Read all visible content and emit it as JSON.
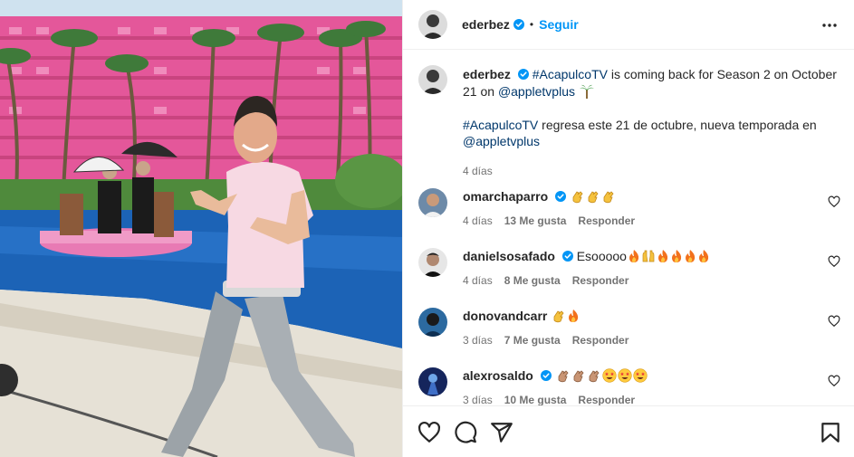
{
  "post": {
    "author": "ederbez",
    "separator": "•",
    "follow_label": "Seguir",
    "colors": {
      "accent": "#0095f6",
      "link": "#00376b",
      "muted": "#737373",
      "verified": "#0095f6"
    }
  },
  "caption": {
    "author": "ederbez",
    "line1": "#AcapulcoTV is coming back for Season 2 on October 21 on @appletvplus",
    "line1_tag1": "#AcapulcoTV",
    "line1_mid": " is coming back for Season 2 on October 21 on ",
    "line1_tag2": "@appletvplus",
    "line2_tag1": "#AcapulcoTV",
    "line2_mid": " regresa este 21 de octubre, nueva temporada en ",
    "line2_tag2": "@appletvplus",
    "time": "4 días"
  },
  "comments": [
    {
      "user": "omarchaparro",
      "text": "",
      "emojis": [
        "clap",
        "clap",
        "clap"
      ],
      "time": "4 días",
      "likes": "13 Me gusta",
      "reply": "Responder"
    },
    {
      "user": "danielsosafado",
      "text": "Esooooo",
      "emojis": [
        "fire",
        "raised-hands",
        "fire",
        "fire",
        "fire",
        "fire"
      ],
      "time": "4 días",
      "likes": "8 Me gusta",
      "reply": "Responder"
    },
    {
      "user": "donovandcarr",
      "text": "",
      "emojis": [
        "clap",
        "fire"
      ],
      "time": "3 días",
      "likes": "7 Me gusta",
      "reply": "Responder"
    },
    {
      "user": "alexrosaldo",
      "text": "",
      "emojis": [
        "clap-medium",
        "clap-medium",
        "clap-medium",
        "star-struck",
        "star-struck",
        "star-struck"
      ],
      "time": "3 días",
      "likes": "10 Me gusta",
      "reply": "Responder"
    }
  ],
  "icons": {
    "header": [
      "avatar",
      "verified-badge-icon",
      "more-options-icon"
    ],
    "actions": [
      "heart-icon",
      "comment-icon",
      "share-icon",
      "bookmark-icon"
    ]
  }
}
